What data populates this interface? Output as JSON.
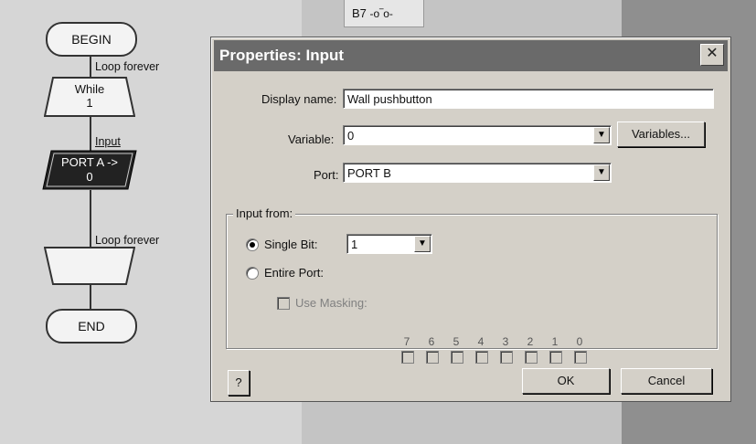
{
  "background": {
    "b7_label": "B7",
    "flowchart": {
      "begin": "BEGIN",
      "loop_label_1": "Loop forever",
      "while_label": "While",
      "while_value": "1",
      "input_label": "Input",
      "port_text": "PORT A ->",
      "port_value": "0",
      "loop_label_2": "Loop forever",
      "end": "END"
    }
  },
  "dialog": {
    "title": "Properties: Input",
    "close_icon": "✕",
    "display_name_label": "Display name:",
    "display_name_value": "Wall pushbutton",
    "variable_label": "Variable:",
    "variable_value": "0",
    "variables_button": "Variables...",
    "port_label": "Port:",
    "port_value": "PORT B",
    "input_from_label": "Input from:",
    "single_bit_label": "Single Bit:",
    "single_bit_value": "1",
    "entire_port_label": "Entire Port:",
    "use_masking_label": "Use Masking:",
    "bits": [
      "7",
      "6",
      "5",
      "4",
      "3",
      "2",
      "1",
      "0"
    ],
    "help_button": "?",
    "ok_button": "OK",
    "cancel_button": "Cancel",
    "selected_mode": "single_bit"
  },
  "colors": {
    "dialog_face": "#d4d0c8",
    "titlebar": "#6a6a6a",
    "port_shape": "#222222"
  }
}
